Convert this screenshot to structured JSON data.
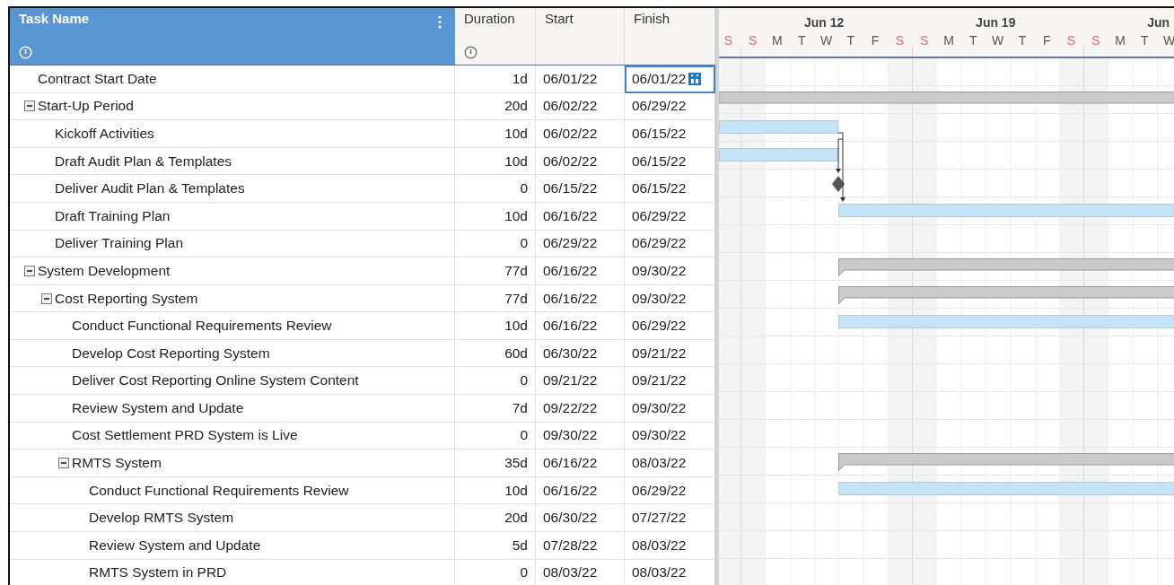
{
  "columns": [
    {
      "label": "Task Name",
      "selected": true,
      "info": true
    },
    {
      "label": "Duration",
      "selected": false,
      "info": true
    },
    {
      "label": "Start",
      "selected": false,
      "info": false
    },
    {
      "label": "Finish",
      "selected": false,
      "info": false
    }
  ],
  "timeline": {
    "weeks": [
      {
        "label": "Jun 12"
      },
      {
        "label": "Jun 19"
      },
      {
        "label": "Jun"
      }
    ],
    "days": [
      {
        "letter": "S",
        "weekend": true
      },
      {
        "letter": "S",
        "weekend": true
      },
      {
        "letter": "M",
        "weekend": false
      },
      {
        "letter": "T",
        "weekend": false
      },
      {
        "letter": "W",
        "weekend": false
      },
      {
        "letter": "T",
        "weekend": false
      },
      {
        "letter": "F",
        "weekend": false
      },
      {
        "letter": "S",
        "weekend": true
      },
      {
        "letter": "S",
        "weekend": true
      },
      {
        "letter": "M",
        "weekend": false
      },
      {
        "letter": "T",
        "weekend": false
      },
      {
        "letter": "W",
        "weekend": false
      },
      {
        "letter": "T",
        "weekend": false
      },
      {
        "letter": "F",
        "weekend": false
      },
      {
        "letter": "S",
        "weekend": true
      },
      {
        "letter": "S",
        "weekend": true
      },
      {
        "letter": "M",
        "weekend": false
      },
      {
        "letter": "T",
        "weekend": false
      },
      {
        "letter": "W",
        "weekend": false
      }
    ]
  },
  "tasks": [
    {
      "name": "Contract Start Date",
      "duration": "1d",
      "start": "06/01/22",
      "finish": "06/01/22",
      "kind": "task",
      "finish_selected": true
    },
    {
      "name": "Start-Up Period",
      "duration": "20d",
      "start": "06/02/22",
      "finish": "06/29/22",
      "kind": "summary",
      "finish_selected": false,
      "expanded": true,
      "children": [
        {
          "name": "Kickoff Activities",
          "duration": "10d",
          "start": "06/02/22",
          "finish": "06/15/22",
          "kind": "task",
          "finish_selected": false
        },
        {
          "name": "Draft Audit Plan & Templates",
          "duration": "10d",
          "start": "06/02/22",
          "finish": "06/15/22",
          "kind": "task",
          "finish_selected": false
        },
        {
          "name": "Deliver Audit Plan & Templates",
          "duration": "0",
          "start": "06/15/22",
          "finish": "06/15/22",
          "kind": "milestone",
          "finish_selected": false
        },
        {
          "name": "Draft Training Plan",
          "duration": "10d",
          "start": "06/16/22",
          "finish": "06/29/22",
          "kind": "task",
          "finish_selected": false
        },
        {
          "name": "Deliver Training Plan",
          "duration": "0",
          "start": "06/29/22",
          "finish": "06/29/22",
          "kind": "milestone",
          "finish_selected": false
        }
      ]
    },
    {
      "name": "System Development",
      "duration": "77d",
      "start": "06/16/22",
      "finish": "09/30/22",
      "kind": "summary",
      "finish_selected": false,
      "expanded": true,
      "children": [
        {
          "name": "Cost Reporting System",
          "duration": "77d",
          "start": "06/16/22",
          "finish": "09/30/22",
          "kind": "summary",
          "finish_selected": false,
          "expanded": true,
          "children": [
            {
              "name": "Conduct Functional Requirements Review",
              "duration": "10d",
              "start": "06/16/22",
              "finish": "06/29/22",
              "kind": "task",
              "finish_selected": false
            },
            {
              "name": "Develop Cost Reporting System",
              "duration": "60d",
              "start": "06/30/22",
              "finish": "09/21/22",
              "kind": "task",
              "finish_selected": false
            },
            {
              "name": "Deliver Cost Reporting Online System Content",
              "duration": "0",
              "start": "09/21/22",
              "finish": "09/21/22",
              "kind": "milestone",
              "finish_selected": false
            },
            {
              "name": "Review System and Update",
              "duration": "7d",
              "start": "09/22/22",
              "finish": "09/30/22",
              "kind": "task",
              "finish_selected": false
            },
            {
              "name": "Cost Settlement PRD System is Live",
              "duration": "0",
              "start": "09/30/22",
              "finish": "09/30/22",
              "kind": "milestone",
              "finish_selected": false
            },
            {
              "name": "RMTS System",
              "duration": "35d",
              "start": "06/16/22",
              "finish": "08/03/22",
              "kind": "summary",
              "finish_selected": false,
              "expanded": true,
              "children": [
                {
                  "name": "Conduct Functional Requirements Review",
                  "duration": "10d",
                  "start": "06/16/22",
                  "finish": "06/29/22",
                  "kind": "task",
                  "finish_selected": false
                },
                {
                  "name": "Develop RMTS System",
                  "duration": "20d",
                  "start": "06/30/22",
                  "finish": "07/27/22",
                  "kind": "task",
                  "finish_selected": false
                },
                {
                  "name": "Review System and Update",
                  "duration": "5d",
                  "start": "07/28/22",
                  "finish": "08/03/22",
                  "kind": "task",
                  "finish_selected": false
                },
                {
                  "name": "RMTS System in PRD",
                  "duration": "0",
                  "start": "08/03/22",
                  "finish": "08/03/22",
                  "kind": "milestone",
                  "finish_selected": false
                }
              ]
            }
          ]
        }
      ]
    }
  ]
}
